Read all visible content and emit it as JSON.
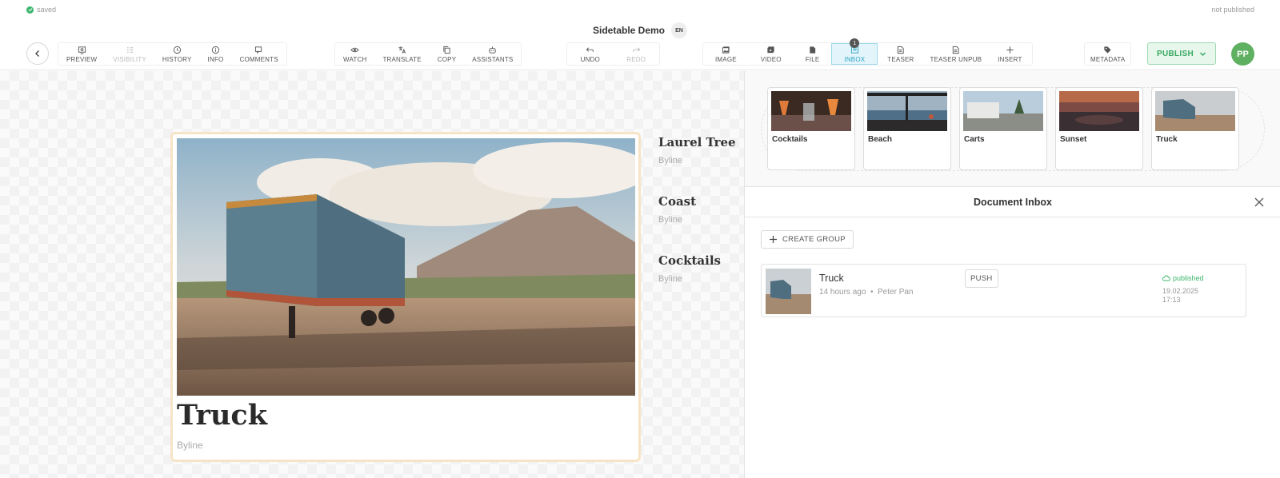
{
  "status": {
    "saved": "saved",
    "publish_state": "not published"
  },
  "document": {
    "title": "Sidetable Demo",
    "language": "EN"
  },
  "toolbar": {
    "group1": [
      {
        "label": "PREVIEW",
        "icon": "preview-icon",
        "disabled": false
      },
      {
        "label": "VISIBILITY",
        "icon": "visibility-icon",
        "disabled": true
      },
      {
        "label": "HISTORY",
        "icon": "history-icon",
        "disabled": false
      },
      {
        "label": "INFO",
        "icon": "info-icon",
        "disabled": false
      },
      {
        "label": "COMMENTS",
        "icon": "comments-icon",
        "disabled": false
      }
    ],
    "group2": [
      {
        "label": "WATCH",
        "icon": "watch-icon"
      },
      {
        "label": "TRANSLATE",
        "icon": "translate-icon"
      },
      {
        "label": "COPY",
        "icon": "copy-icon"
      },
      {
        "label": "ASSISTANTS",
        "icon": "assistants-icon"
      }
    ],
    "group3": [
      {
        "label": "UNDO",
        "icon": "undo-icon",
        "disabled": false
      },
      {
        "label": "REDO",
        "icon": "redo-icon",
        "disabled": true
      }
    ],
    "group4": [
      {
        "label": "IMAGE",
        "icon": "image-icon"
      },
      {
        "label": "VIDEO",
        "icon": "video-icon"
      },
      {
        "label": "FILE",
        "icon": "file-icon"
      },
      {
        "label": "INBOX",
        "icon": "inbox-icon",
        "active": true,
        "count": "1"
      },
      {
        "label": "TEASER",
        "icon": "teaser-icon"
      },
      {
        "label": "TEASER UNPUB",
        "icon": "teaser-unpub-icon"
      },
      {
        "label": "INSERT",
        "icon": "plus-icon"
      }
    ],
    "metadata": {
      "label": "METADATA",
      "icon": "tag-icon"
    },
    "publish_label": "PUBLISH",
    "user_initials": "PP"
  },
  "main_card": {
    "title": "Truck",
    "byline": "Byline"
  },
  "side_list": [
    {
      "title": "Laurel Tree",
      "byline": "Byline"
    },
    {
      "title": "Coast",
      "byline": "Byline"
    },
    {
      "title": "Cocktails",
      "byline": "Byline"
    }
  ],
  "media_strip": [
    {
      "label": "Cocktails"
    },
    {
      "label": "Beach"
    },
    {
      "label": "Carts"
    },
    {
      "label": "Sunset"
    },
    {
      "label": "Truck"
    }
  ],
  "inbox": {
    "title": "Document Inbox",
    "create_group_label": "CREATE GROUP",
    "items": [
      {
        "title": "Truck",
        "time": "14 hours ago",
        "author": "Peter Pan",
        "push_label": "PUSH",
        "status": "published",
        "date": "19.02.2025",
        "clock": "17:13"
      }
    ]
  },
  "colors": {
    "accent": "#2fa3c4",
    "publish": "#3aa862",
    "card_border": "#f7e4c6",
    "avatar": "#5fb061"
  }
}
